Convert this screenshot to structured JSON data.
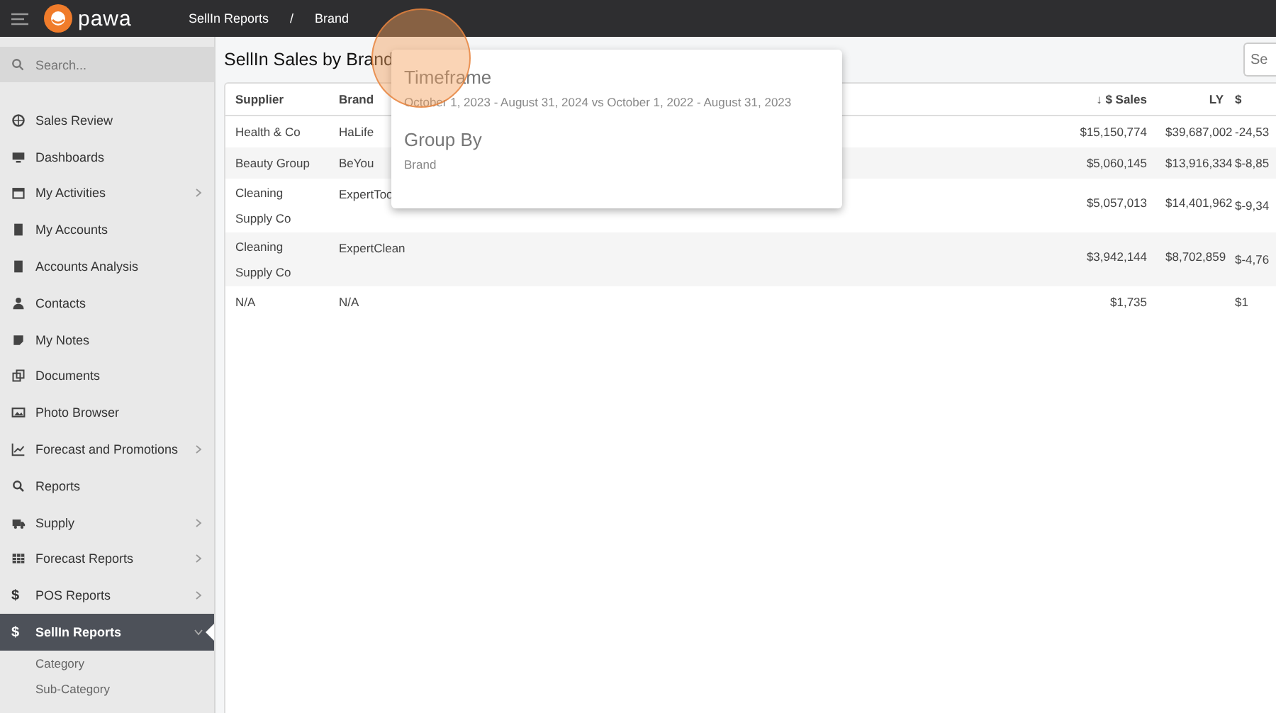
{
  "topbar": {
    "logo": "pawa",
    "breadcrumbs": [
      "SellIn Reports",
      "/",
      "Brand"
    ]
  },
  "sidebar": {
    "search": {
      "placeholder": "Search..."
    },
    "items": [
      {
        "label": "Sales Review",
        "has_arrow": false,
        "selected": false
      },
      {
        "label": "Dashboards",
        "has_arrow": false,
        "selected": false
      },
      {
        "label": "My Activities",
        "has_arrow": true,
        "selected": false
      },
      {
        "label": "My Accounts",
        "has_arrow": false,
        "selected": false
      },
      {
        "label": "Accounts Analysis",
        "has_arrow": false,
        "selected": false
      },
      {
        "label": "Contacts",
        "has_arrow": false,
        "selected": false
      },
      {
        "label": "My Notes",
        "has_arrow": false,
        "selected": false
      },
      {
        "label": "Documents",
        "has_arrow": false,
        "selected": false
      },
      {
        "label": "Photo Browser",
        "has_arrow": false,
        "selected": false
      },
      {
        "label": "Forecast and Promotions",
        "has_arrow": true,
        "selected": false
      },
      {
        "label": "Reports",
        "has_arrow": false,
        "selected": false
      },
      {
        "label": "Supply",
        "has_arrow": true,
        "selected": false
      },
      {
        "label": "Forecast Reports",
        "has_arrow": true,
        "selected": false
      },
      {
        "label": "POS Reports",
        "icon_glyph": "$",
        "has_arrow": true,
        "selected": false
      },
      {
        "label": "SellIn Reports",
        "icon_glyph": "$",
        "has_arrow": true,
        "selected": true,
        "expanded": true,
        "children": [
          {
            "label": "Category"
          },
          {
            "label": "Sub-Category"
          }
        ]
      }
    ]
  },
  "main": {
    "title": "SellIn Sales by Brand",
    "search": {
      "placeholder": "Se"
    },
    "table": {
      "columns": [
        "Supplier",
        "Brand",
        "",
        "↓ $ Sales",
        "LY",
        "$"
      ],
      "rows": [
        [
          "Health & Co",
          "HaLife",
          "",
          "$15,150,774",
          "$39,687,002",
          "-24,53"
        ],
        [
          "Beauty Group",
          "BeYou",
          "",
          "$5,060,145",
          "$13,916,334",
          "$-8,85"
        ],
        [
          "Cleaning Supply Co",
          "ExpertToo",
          "",
          "$5,057,013",
          "$14,401,962",
          "$-9,34"
        ],
        [
          "Cleaning Supply Co",
          "ExpertClean",
          "",
          "$3,942,144",
          "$8,702,859",
          "$-4,76"
        ],
        [
          "N/A",
          "N/A",
          "",
          "$1,735",
          "",
          "$1"
        ]
      ]
    }
  },
  "popover": {
    "sections": [
      {
        "heading": "Timeframe",
        "value": "October 1, 2023 - August 31, 2024 vs October 1, 2022 - August 31, 2023"
      },
      {
        "heading": "Group By",
        "value": "Brand"
      }
    ]
  }
}
